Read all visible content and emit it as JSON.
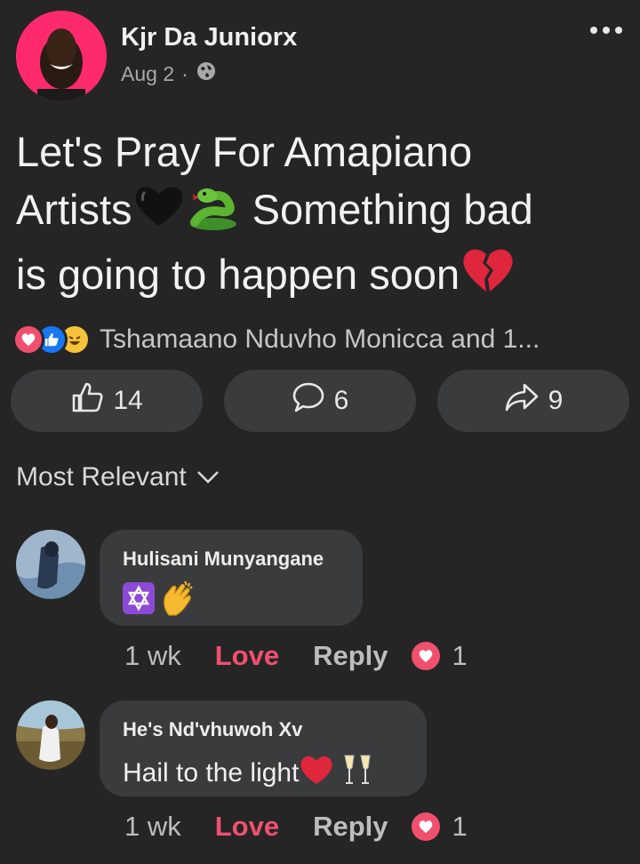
{
  "post": {
    "author": "Kjr Da Juniorx",
    "date": "Aug 2",
    "separator": "·",
    "privacy_icon": "globe-icon",
    "text_line1": "Let's Pray For Amapiano",
    "text_line2a": "Artists",
    "text_line2b": " Something bad",
    "text_line3": "is going to happen soon",
    "emojis": [
      "black-heart-icon",
      "snake-icon",
      "broken-heart-icon"
    ]
  },
  "reactions": {
    "icons": [
      "love-reaction-icon",
      "like-reaction-icon",
      "haha-reaction-icon"
    ],
    "summary": "Tshamaano Nduvho Monicca and 1..."
  },
  "actions": {
    "like_count": "14",
    "comment_count": "6",
    "share_count": "9"
  },
  "sort": {
    "label": "Most Relevant"
  },
  "comments": [
    {
      "name": "Hulisani Munyangane",
      "text": "",
      "emojis": [
        "star-of-david-icon",
        "clapping-hands-icon"
      ],
      "time": "1 wk",
      "love": "Love",
      "reply": "Reply",
      "reaction_count": "1"
    },
    {
      "name": "He's Nd'vhuwoh Xv",
      "text": "Hail to the light",
      "emojis": [
        "red-heart-icon",
        "clinking-glasses-icon"
      ],
      "time": "1 wk",
      "love": "Love",
      "reply": "Reply",
      "reaction_count": "1"
    }
  ],
  "colors": {
    "background": "#252526",
    "pill": "#3a3b3c",
    "love_accent": "#f0506e",
    "avatar_ring": "#ff2a6d"
  }
}
